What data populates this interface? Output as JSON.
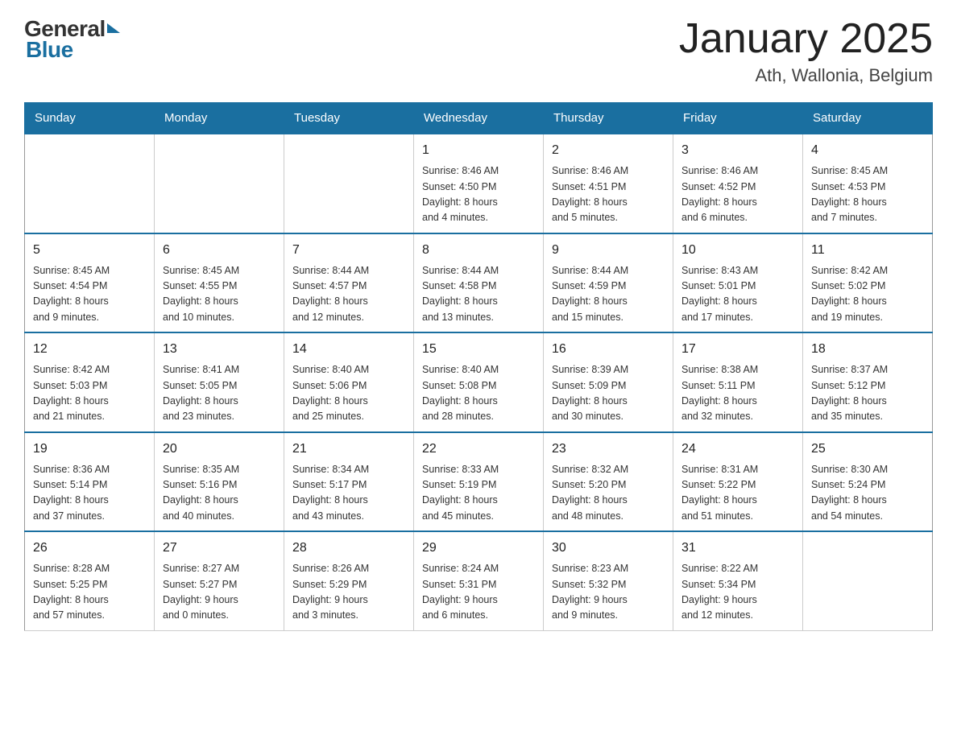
{
  "header": {
    "title": "January 2025",
    "subtitle": "Ath, Wallonia, Belgium"
  },
  "days_of_week": [
    "Sunday",
    "Monday",
    "Tuesday",
    "Wednesday",
    "Thursday",
    "Friday",
    "Saturday"
  ],
  "weeks": [
    {
      "days": [
        {
          "number": "",
          "info": ""
        },
        {
          "number": "",
          "info": ""
        },
        {
          "number": "",
          "info": ""
        },
        {
          "number": "1",
          "info": "Sunrise: 8:46 AM\nSunset: 4:50 PM\nDaylight: 8 hours\nand 4 minutes."
        },
        {
          "number": "2",
          "info": "Sunrise: 8:46 AM\nSunset: 4:51 PM\nDaylight: 8 hours\nand 5 minutes."
        },
        {
          "number": "3",
          "info": "Sunrise: 8:46 AM\nSunset: 4:52 PM\nDaylight: 8 hours\nand 6 minutes."
        },
        {
          "number": "4",
          "info": "Sunrise: 8:45 AM\nSunset: 4:53 PM\nDaylight: 8 hours\nand 7 minutes."
        }
      ]
    },
    {
      "days": [
        {
          "number": "5",
          "info": "Sunrise: 8:45 AM\nSunset: 4:54 PM\nDaylight: 8 hours\nand 9 minutes."
        },
        {
          "number": "6",
          "info": "Sunrise: 8:45 AM\nSunset: 4:55 PM\nDaylight: 8 hours\nand 10 minutes."
        },
        {
          "number": "7",
          "info": "Sunrise: 8:44 AM\nSunset: 4:57 PM\nDaylight: 8 hours\nand 12 minutes."
        },
        {
          "number": "8",
          "info": "Sunrise: 8:44 AM\nSunset: 4:58 PM\nDaylight: 8 hours\nand 13 minutes."
        },
        {
          "number": "9",
          "info": "Sunrise: 8:44 AM\nSunset: 4:59 PM\nDaylight: 8 hours\nand 15 minutes."
        },
        {
          "number": "10",
          "info": "Sunrise: 8:43 AM\nSunset: 5:01 PM\nDaylight: 8 hours\nand 17 minutes."
        },
        {
          "number": "11",
          "info": "Sunrise: 8:42 AM\nSunset: 5:02 PM\nDaylight: 8 hours\nand 19 minutes."
        }
      ]
    },
    {
      "days": [
        {
          "number": "12",
          "info": "Sunrise: 8:42 AM\nSunset: 5:03 PM\nDaylight: 8 hours\nand 21 minutes."
        },
        {
          "number": "13",
          "info": "Sunrise: 8:41 AM\nSunset: 5:05 PM\nDaylight: 8 hours\nand 23 minutes."
        },
        {
          "number": "14",
          "info": "Sunrise: 8:40 AM\nSunset: 5:06 PM\nDaylight: 8 hours\nand 25 minutes."
        },
        {
          "number": "15",
          "info": "Sunrise: 8:40 AM\nSunset: 5:08 PM\nDaylight: 8 hours\nand 28 minutes."
        },
        {
          "number": "16",
          "info": "Sunrise: 8:39 AM\nSunset: 5:09 PM\nDaylight: 8 hours\nand 30 minutes."
        },
        {
          "number": "17",
          "info": "Sunrise: 8:38 AM\nSunset: 5:11 PM\nDaylight: 8 hours\nand 32 minutes."
        },
        {
          "number": "18",
          "info": "Sunrise: 8:37 AM\nSunset: 5:12 PM\nDaylight: 8 hours\nand 35 minutes."
        }
      ]
    },
    {
      "days": [
        {
          "number": "19",
          "info": "Sunrise: 8:36 AM\nSunset: 5:14 PM\nDaylight: 8 hours\nand 37 minutes."
        },
        {
          "number": "20",
          "info": "Sunrise: 8:35 AM\nSunset: 5:16 PM\nDaylight: 8 hours\nand 40 minutes."
        },
        {
          "number": "21",
          "info": "Sunrise: 8:34 AM\nSunset: 5:17 PM\nDaylight: 8 hours\nand 43 minutes."
        },
        {
          "number": "22",
          "info": "Sunrise: 8:33 AM\nSunset: 5:19 PM\nDaylight: 8 hours\nand 45 minutes."
        },
        {
          "number": "23",
          "info": "Sunrise: 8:32 AM\nSunset: 5:20 PM\nDaylight: 8 hours\nand 48 minutes."
        },
        {
          "number": "24",
          "info": "Sunrise: 8:31 AM\nSunset: 5:22 PM\nDaylight: 8 hours\nand 51 minutes."
        },
        {
          "number": "25",
          "info": "Sunrise: 8:30 AM\nSunset: 5:24 PM\nDaylight: 8 hours\nand 54 minutes."
        }
      ]
    },
    {
      "days": [
        {
          "number": "26",
          "info": "Sunrise: 8:28 AM\nSunset: 5:25 PM\nDaylight: 8 hours\nand 57 minutes."
        },
        {
          "number": "27",
          "info": "Sunrise: 8:27 AM\nSunset: 5:27 PM\nDaylight: 9 hours\nand 0 minutes."
        },
        {
          "number": "28",
          "info": "Sunrise: 8:26 AM\nSunset: 5:29 PM\nDaylight: 9 hours\nand 3 minutes."
        },
        {
          "number": "29",
          "info": "Sunrise: 8:24 AM\nSunset: 5:31 PM\nDaylight: 9 hours\nand 6 minutes."
        },
        {
          "number": "30",
          "info": "Sunrise: 8:23 AM\nSunset: 5:32 PM\nDaylight: 9 hours\nand 9 minutes."
        },
        {
          "number": "31",
          "info": "Sunrise: 8:22 AM\nSunset: 5:34 PM\nDaylight: 9 hours\nand 12 minutes."
        },
        {
          "number": "",
          "info": ""
        }
      ]
    }
  ]
}
